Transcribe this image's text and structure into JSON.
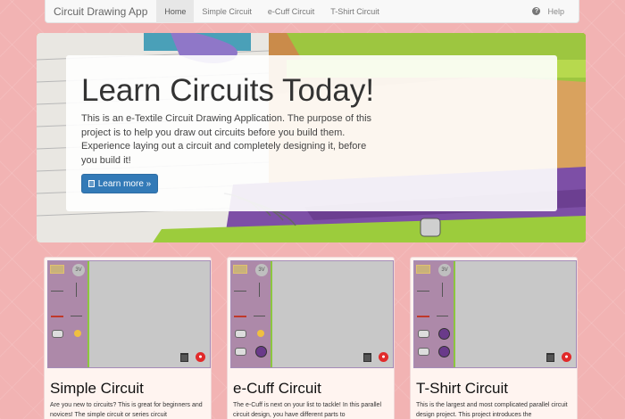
{
  "navbar": {
    "brand": "Circuit Drawing App",
    "items": [
      {
        "label": "Home",
        "active": true
      },
      {
        "label": "Simple Circuit",
        "active": false
      },
      {
        "label": "e-Cuff Circuit",
        "active": false
      },
      {
        "label": "T-Shirt Circuit",
        "active": false
      }
    ],
    "help": "Help"
  },
  "hero": {
    "title": "Learn Circuits Today!",
    "text": "This is an e-Textile Circuit Drawing Application. The purpose of this project is to help you draw out circuits before you build them. Experience laying out a circuit and completely designing it, before you build it!",
    "button": "Learn more »"
  },
  "cards": [
    {
      "title": "Simple Circuit",
      "text": "Are you new to circuits? This is great for beginners and novices! The simple circuit or series circuit",
      "palette_badge": "3V"
    },
    {
      "title": "e-Cuff Circuit",
      "text": "The e-Cuff is next on your list to tackle! In this parallel circuit design, you have different parts to",
      "palette_badge": "3V"
    },
    {
      "title": "T-Shirt Circuit",
      "text": "This is the largest and most complicated parallel circuit design project. This project introduces the",
      "palette_badge": "3V"
    }
  ],
  "colors": {
    "page_background": "#f2b3b3",
    "navbar_background": "#f8f8f8",
    "primary_button": "#337ab7",
    "palette_background": "#ad89a9",
    "palette_border": "#8cc63f",
    "canvas_background": "#c8c8c8",
    "reset_red": "#e12a2a"
  }
}
